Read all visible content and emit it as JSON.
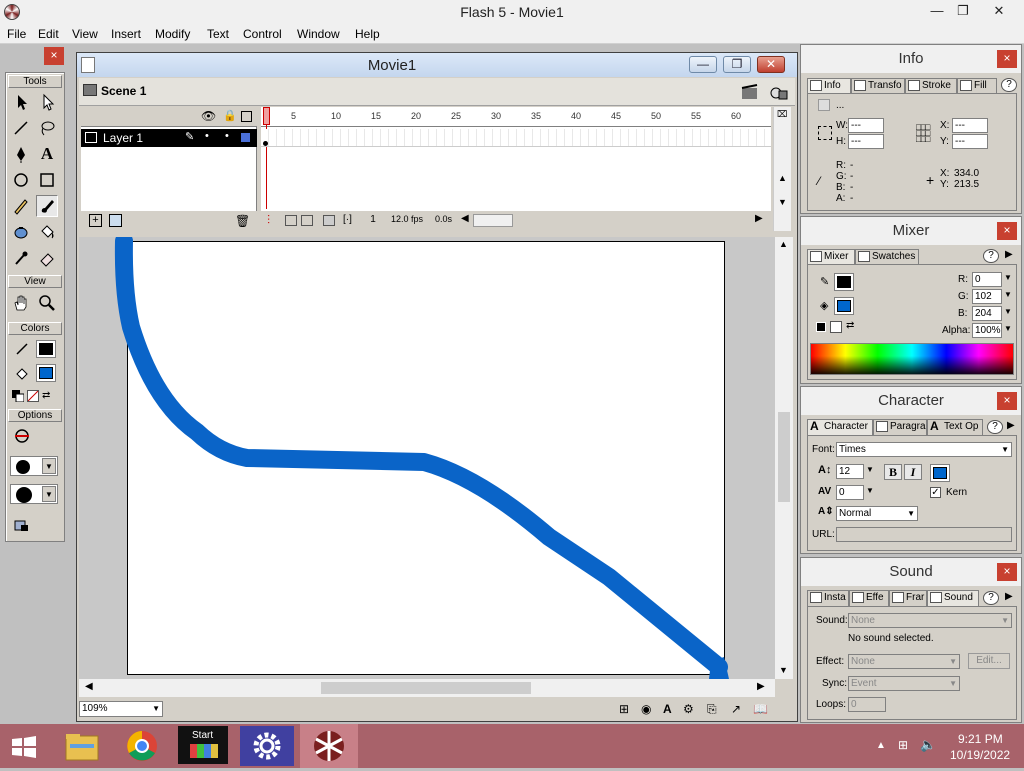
{
  "app": {
    "title": "Flash 5 - Movie1"
  },
  "window_controls": {
    "minimize": "—",
    "maximize": "❐",
    "close": "✕"
  },
  "menu": [
    "File",
    "Edit",
    "View",
    "Insert",
    "Modify",
    "Text",
    "Control",
    "Window",
    "Help"
  ],
  "tools_panel": {
    "title": "Tools",
    "view_label": "View",
    "colors_label": "Colors",
    "options_label": "Options",
    "stroke_color": "#000000",
    "fill_color": "#0066cc",
    "close": "×"
  },
  "movie": {
    "title": "Movie1",
    "scene": "Scene 1",
    "layer": "Layer 1",
    "frame_numbers": [
      "5",
      "10",
      "15",
      "20",
      "25",
      "30",
      "35",
      "40",
      "45",
      "50",
      "55",
      "60"
    ],
    "current_frame": "1",
    "fps": "12.0 fps",
    "time": "0.0s",
    "zoom": "109%",
    "stroke_color": "#0a64c8"
  },
  "info_panel": {
    "title": "Info",
    "tabs": [
      "Info",
      "Transfo",
      "Stroke",
      "Fill"
    ],
    "help": "?",
    "close": "×",
    "dots": "...",
    "w_label": "W:",
    "w_value": "---",
    "h_label": "H:",
    "h_value": "---",
    "x_label": "X:",
    "x_value": "---",
    "y_label": "Y:",
    "y_value": "---",
    "r_label": "R:",
    "r_value": "-",
    "g_label": "G:",
    "g_value": "-",
    "b_label": "B:",
    "b_value": "-",
    "a_label": "A:",
    "a_value": "-",
    "cursor_x_label": "X:",
    "cursor_x": "334.0",
    "cursor_y_label": "Y:",
    "cursor_y": "213.5"
  },
  "mixer_panel": {
    "title": "Mixer",
    "tabs": [
      "Mixer",
      "Swatches"
    ],
    "help": "?",
    "close": "×",
    "r_label": "R:",
    "r_value": "0",
    "g_label": "G:",
    "g_value": "102",
    "b_label": "B:",
    "b_value": "204",
    "alpha_label": "Alpha:",
    "alpha_value": "100%",
    "stroke_color": "#000000",
    "fill_color": "#0066cc"
  },
  "character_panel": {
    "title": "Character",
    "tabs": [
      "Character",
      "Paragra",
      "Text Op"
    ],
    "help": "?",
    "close": "×",
    "font_label": "Font:",
    "font_value": "Times",
    "size_value": "12",
    "bold": "B",
    "italic": "I",
    "tracking_value": "0",
    "kern_label": "Kern",
    "baseline_value": "Normal",
    "url_label": "URL:",
    "text_color": "#0066cc"
  },
  "sound_panel": {
    "title": "Sound",
    "tabs": [
      "Insta",
      "Effe",
      "Frar",
      "Sound"
    ],
    "help": "?",
    "close": "×",
    "sound_label": "Sound:",
    "sound_value": "None",
    "no_sound": "No sound selected.",
    "effect_label": "Effect:",
    "effect_value": "None",
    "edit_button": "Edit...",
    "sync_label": "Sync:",
    "sync_value": "Event",
    "loops_label": "Loops:",
    "loops_value": "0"
  },
  "taskbar": {
    "start_tile_label": "Start",
    "time": "9:21 PM",
    "date": "10/19/2022"
  }
}
